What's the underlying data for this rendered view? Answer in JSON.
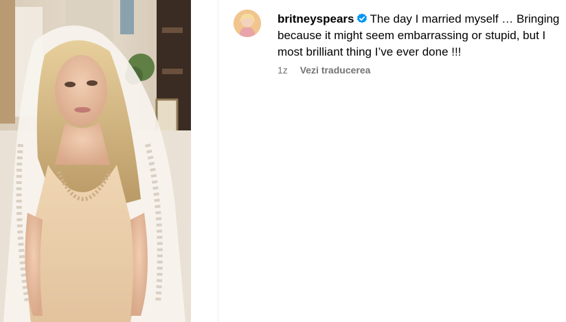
{
  "post": {
    "media": {
      "icon": "photo-image"
    },
    "author": {
      "username": "britneyspears",
      "verified_icon": "verified-badge-icon",
      "avatar_icon": "avatar-photo"
    },
    "caption": {
      "line1": "The day I married myself … Bringing",
      "line2": "because it might seem embarrassing or stupid, but I",
      "line3": "most brilliant thing I’ve ever done !!!"
    },
    "meta": {
      "timestamp": "1z",
      "translate_label": "Vezi traducerea"
    },
    "colors": {
      "verified_blue": "#0095f6",
      "meta_gray": "#737373",
      "divider": "#efefef"
    }
  }
}
